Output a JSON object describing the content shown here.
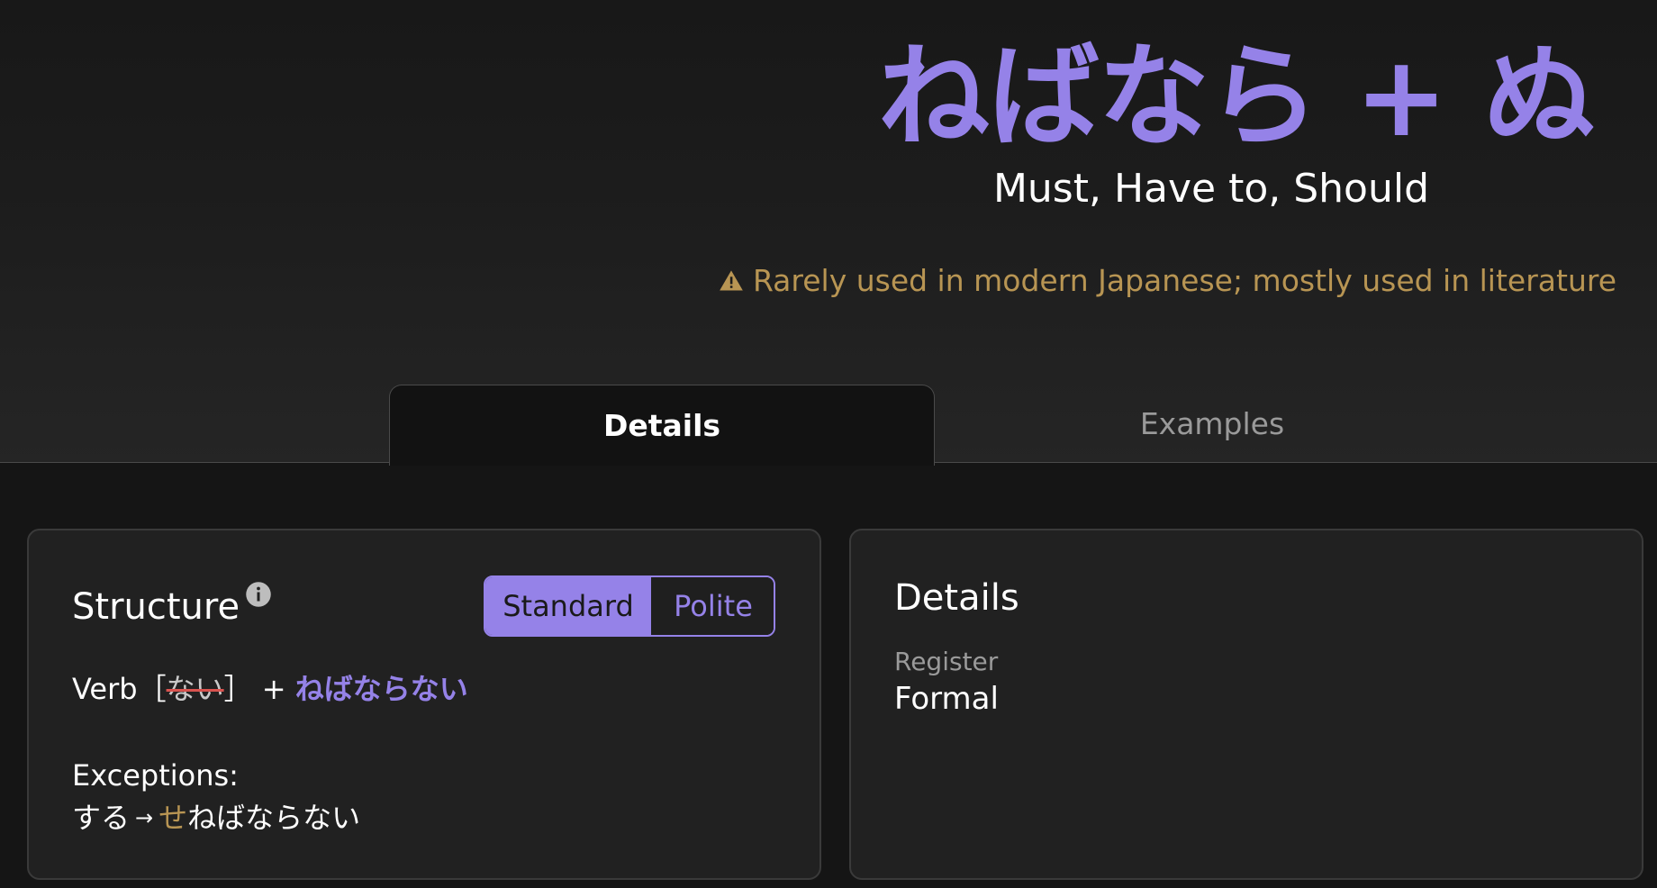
{
  "hero": {
    "title": "ねばなら + ぬ",
    "subtitle": "Must, Have to, Should",
    "notice": "Rarely used in modern Japanese; mostly used in literature",
    "notice_icon": "warning-icon",
    "notice_color": "#b89553"
  },
  "tabs": [
    {
      "label": "Details",
      "active": true
    },
    {
      "label": "Examples",
      "active": false
    }
  ],
  "structure": {
    "title": "Structure",
    "info_icon": "info-icon",
    "toggle": {
      "options": [
        "Standard",
        "Polite"
      ],
      "selected": "Standard"
    },
    "formula": {
      "verb": "Verb",
      "bracket_open": "［",
      "removed": "ない",
      "bracket_close": "］",
      "plus": " + ",
      "ending": "ねばならない"
    },
    "exceptions_label": "Exceptions:",
    "exception": {
      "from": "する",
      "arrow": "→",
      "highlight": "せ",
      "rest": "ねばならない"
    }
  },
  "details": {
    "title": "Details",
    "register_label": "Register",
    "register_value": "Formal"
  },
  "colors": {
    "accent": "#9582e8",
    "warning": "#b89553",
    "strike": "#d9534f",
    "background": "#181818",
    "card": "#212121"
  }
}
